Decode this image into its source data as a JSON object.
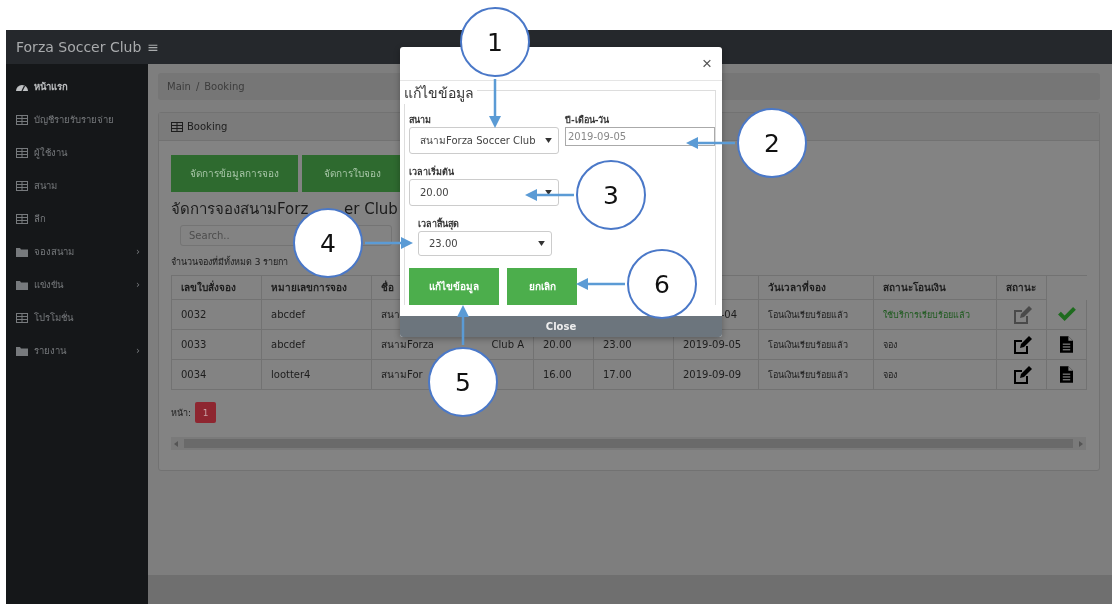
{
  "navbar": {
    "brand": "Forza Soccer Club",
    "menu_glyph": "≡"
  },
  "sidebar": {
    "items": [
      {
        "label": "หน้าแรก",
        "kind": "dashboard",
        "selected": true
      },
      {
        "label": "บัญชีรายรับรายจ่าย",
        "kind": "table",
        "selected": false
      },
      {
        "label": "ผู้ใช้งาน",
        "kind": "table",
        "selected": false
      },
      {
        "label": "สนาม",
        "kind": "table",
        "selected": false
      },
      {
        "label": "ลีก",
        "kind": "table",
        "selected": false
      },
      {
        "label": "จองสนาม",
        "kind": "folder",
        "chevron": "›",
        "selected": false
      },
      {
        "label": "แข่งขัน",
        "kind": "folder",
        "chevron": "›",
        "selected": false
      },
      {
        "label": "โปรโมชั่น",
        "kind": "table",
        "selected": false
      },
      {
        "label": "รายงาน",
        "kind": "folder",
        "chevron": "›",
        "selected": false
      }
    ]
  },
  "breadcrumb": {
    "items": [
      "Main",
      "Booking"
    ],
    "separator": "/"
  },
  "card": {
    "title": "Booking",
    "actions": [
      "จัดการข้อมูลการจอง",
      "จัดการใบจอง"
    ],
    "heading": [
      "จัดการจองสนามForz",
      "er Club"
    ],
    "search": {
      "placeholder": "Search.."
    },
    "count_text": "จำนวนจองที่มีทั้งหมด 3 รายกา",
    "table": {
      "columns": [
        "เลขใบสั่งจอง",
        "หมายเลขการจอง",
        "ชื่อ",
        "วันเวลาที่จอง",
        "สถานะโอนเงิน",
        "สถานะ"
      ],
      "rows": [
        {
          "order_no": "0032",
          "booking_no": "abcdef",
          "field": [
            "สนา"
          ],
          "date": "-04",
          "transfer": "โอนเงินเรียบร้อยแล้ว",
          "status": "ใช้บริการเรียบร้อยแล้ว",
          "completed": true
        },
        {
          "order_no": "0033",
          "booking_no": "abcdef",
          "field": [
            "สนามForza",
            "Club A"
          ],
          "start": "20.00",
          "end": "23.00",
          "date": "2019-09-05",
          "transfer": "โอนเงินเรียบร้อยแล้ว",
          "status": "จอง",
          "completed": false
        },
        {
          "order_no": "0034",
          "booking_no": "lootter4",
          "field": [
            "สนามFor"
          ],
          "start": "16.00",
          "end": "17.00",
          "date": "2019-09-09",
          "transfer": "โอนเงินเรียบร้อยแล้ว",
          "status": "จอง",
          "completed": false
        }
      ]
    },
    "pagination": {
      "label": "หน้า:",
      "pages": [
        {
          "label": "1",
          "selected": true
        }
      ]
    }
  },
  "modal": {
    "close_glyph": "×",
    "legend": "แก้ไขข้อมูล",
    "field_label": "สนาม",
    "field_value": "สนามForza Soccer Club",
    "date_label": "ปี-เดือน-วัน",
    "date_value": "2019-09-05",
    "start_label": "เวลาเริ่มต้น",
    "start_value": "20.00",
    "end_label": "เวลาสิ้นสุด",
    "end_value": "23.00",
    "buttons": [
      "แก้ไขข้อมูล",
      "ยกเลิก"
    ],
    "footer_button": "Close"
  },
  "callouts": [
    "1",
    "2",
    "3",
    "4",
    "5",
    "6"
  ]
}
